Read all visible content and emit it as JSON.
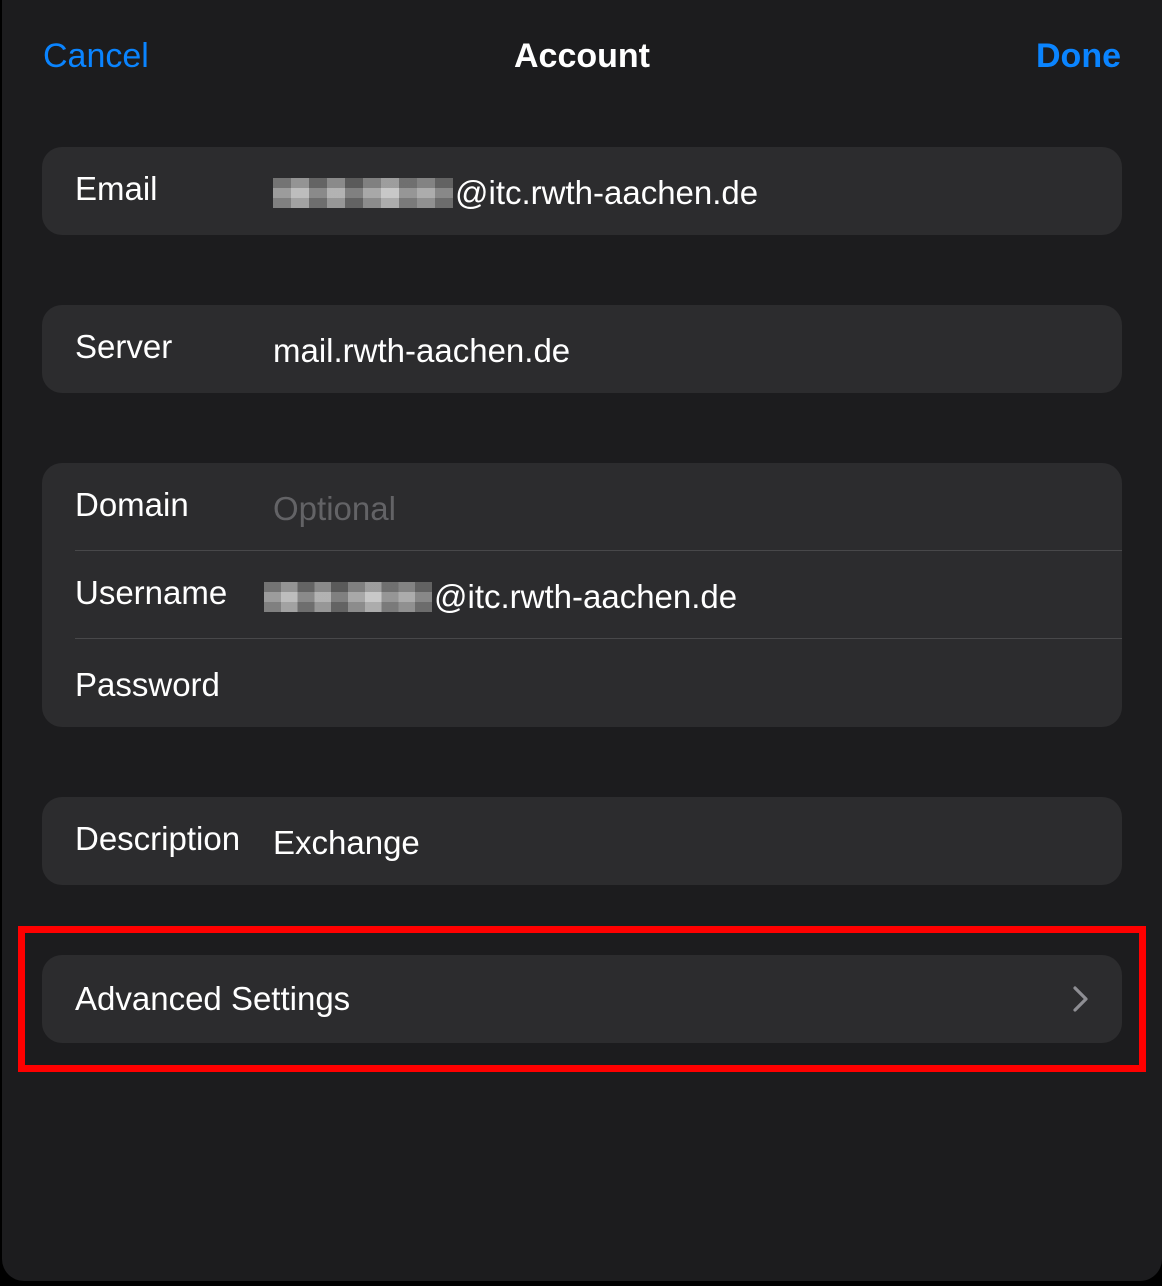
{
  "nav": {
    "cancel_label": "Cancel",
    "title": "Account",
    "done_label": "Done"
  },
  "email": {
    "label": "Email",
    "value_suffix": "@itc.rwth-aachen.de"
  },
  "server": {
    "label": "Server",
    "value": "mail.rwth-aachen.de"
  },
  "credentials": {
    "domain_label": "Domain",
    "domain_placeholder": "Optional",
    "username_label": "Username",
    "username_suffix": "@itc.rwth-aachen.de",
    "password_label": "Password"
  },
  "description": {
    "label": "Description",
    "value": "Exchange"
  },
  "advanced": {
    "label": "Advanced Settings"
  },
  "colors": {
    "accent": "#0a84ff",
    "background": "#1c1c1e",
    "cell": "#2c2c2e",
    "highlight": "#ff0000"
  }
}
